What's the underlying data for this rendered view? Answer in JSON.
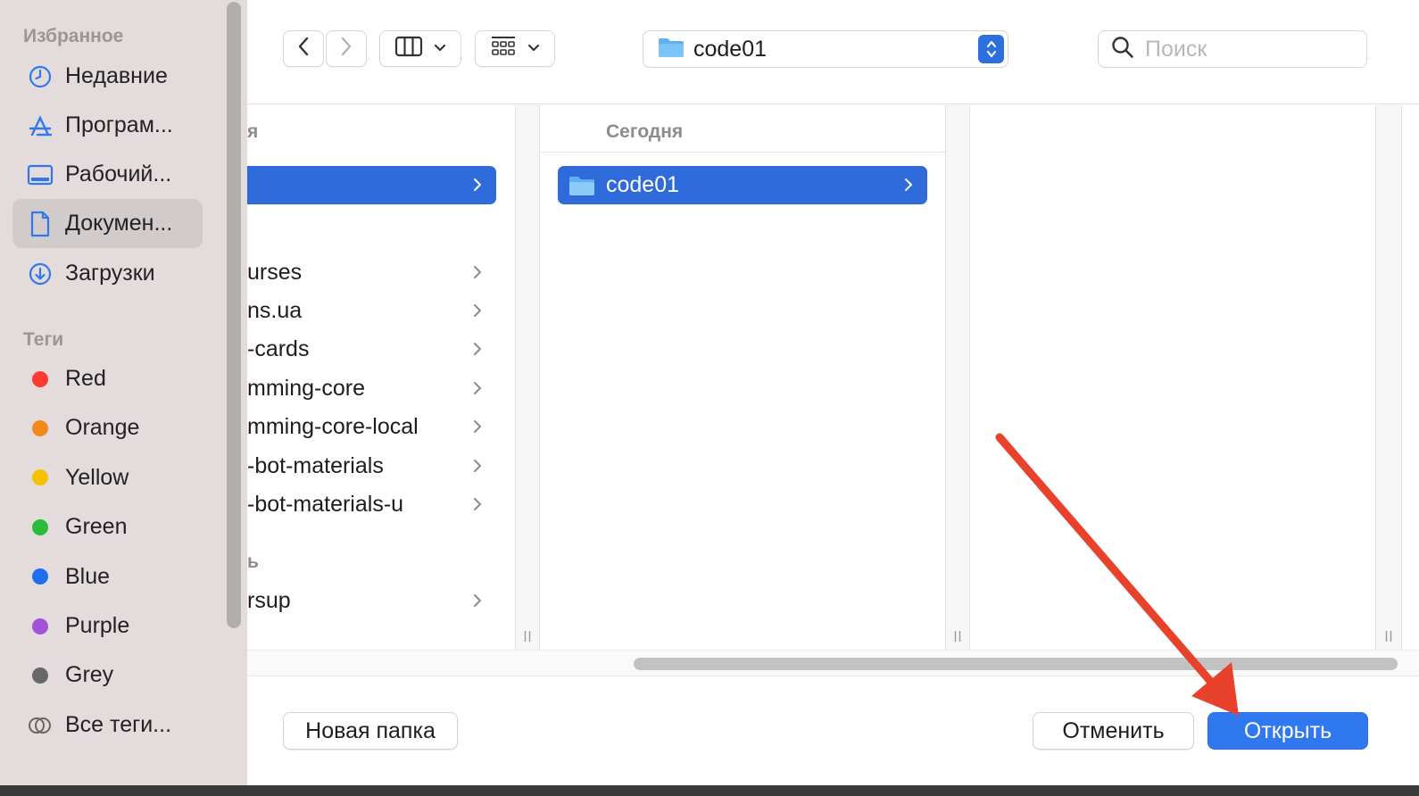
{
  "sidebar": {
    "favorites_title": "Избранное",
    "favorites": [
      {
        "label": "Недавние",
        "icon": "clock-icon"
      },
      {
        "label": "Програм...",
        "icon": "applications-icon"
      },
      {
        "label": "Рабочий...",
        "icon": "desktop-icon"
      },
      {
        "label": "Докумен...",
        "icon": "document-icon",
        "active": true
      },
      {
        "label": "Загрузки",
        "icon": "downloads-icon"
      }
    ],
    "tags_title": "Теги",
    "tags": [
      {
        "label": "Red",
        "color": "#fe3b30"
      },
      {
        "label": "Orange",
        "color": "#f28a1b"
      },
      {
        "label": "Yellow",
        "color": "#f5c100"
      },
      {
        "label": "Green",
        "color": "#29bb3b"
      },
      {
        "label": "Blue",
        "color": "#1f6ef0"
      },
      {
        "label": "Purple",
        "color": "#a152d7"
      },
      {
        "label": "Grey",
        "color": "#67666b"
      }
    ],
    "all_tags_label": "Все теги..."
  },
  "toolbar": {
    "back_icon": "chevron-left-icon",
    "forward_icon": "chevron-right-icon",
    "view_mode_icon": "columns-view-icon",
    "group_icon": "grid-view-icon",
    "path_label": "code01",
    "search_placeholder": "Поиск"
  },
  "column1": {
    "header": "я",
    "group2_header": "ь",
    "items": [
      {
        "label": "",
        "selected": true
      },
      {
        "label": "urses"
      },
      {
        "label": "ns.ua"
      },
      {
        "label": "-cards"
      },
      {
        "label": "mming-core"
      },
      {
        "label": "mming-core-local"
      },
      {
        "label": "-bot-materials"
      },
      {
        "label": "-bot-materials-u"
      },
      {
        "label": "rsup"
      }
    ]
  },
  "column2": {
    "header": "Сегодня",
    "items": [
      {
        "label": "code01",
        "selected": true
      }
    ]
  },
  "footer": {
    "new_folder_label": "Новая папка",
    "cancel_label": "Отменить",
    "open_label": "Открыть"
  },
  "colors": {
    "selection": "#2e6ad9",
    "primary_button": "#2f78f0",
    "annotation_arrow": "#e8412c"
  }
}
